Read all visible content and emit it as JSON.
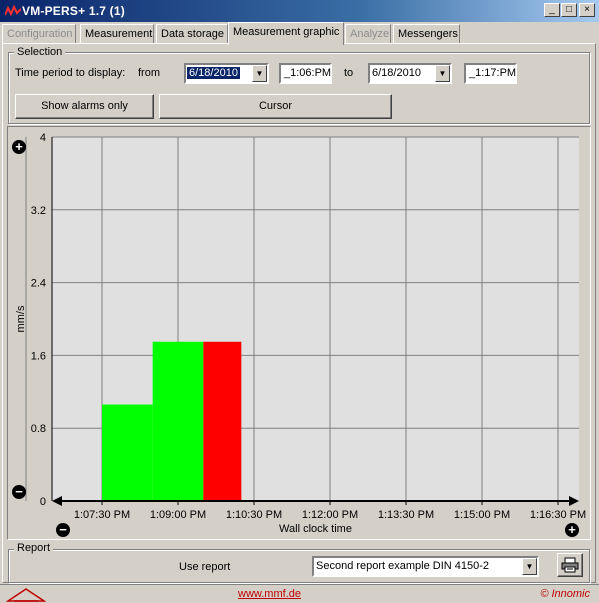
{
  "window": {
    "title": "VM-PERS+ 1.7 (1)",
    "min": "_",
    "max": "□",
    "close": "×"
  },
  "tabs": [
    {
      "label": "Configuration",
      "state": "disabled"
    },
    {
      "label": "Measurement",
      "state": "normal"
    },
    {
      "label": "Data storage",
      "state": "normal"
    },
    {
      "label": "Measurement graphic",
      "state": "active"
    },
    {
      "label": "Analyze",
      "state": "disabled"
    },
    {
      "label": "Messengers",
      "state": "normal"
    }
  ],
  "selection": {
    "group_label": "Selection",
    "time_period_label": "Time period to display:",
    "from_label": "from",
    "from_date": "6/18/2010",
    "from_time": "_1:06:PM",
    "to_label": "to",
    "to_date": "6/18/2010",
    "to_time": "_1:17:PM",
    "show_alarms_button": "Show alarms only",
    "cursor_button": "Cursor"
  },
  "chart_data": {
    "type": "bar",
    "title": "",
    "xlabel": "Wall clock time",
    "ylabel": "mm/s",
    "ylim": [
      0,
      4
    ],
    "yticks": [
      "0",
      "0.8",
      "1.6",
      "2.4",
      "3.2",
      "4"
    ],
    "xtick_labels": [
      "1:07:30 PM",
      "1:09:00 PM",
      "1:10:30 PM",
      "1:12:00 PM",
      "1:13:30 PM",
      "1:15:00 PM",
      "1:16:30 PM"
    ],
    "grid": true,
    "background": "#e0e0e0",
    "bars": [
      {
        "start": "1:07:30 PM",
        "end": "1:08:30 PM",
        "value": 1.06,
        "color": "#00ff00"
      },
      {
        "start": "1:08:30 PM",
        "end": "1:09:30 PM",
        "value": 1.75,
        "color": "#00ff00"
      },
      {
        "start": "1:09:30 PM",
        "end": "1:10:15 PM",
        "value": 1.75,
        "color": "#ff0000"
      }
    ]
  },
  "chart_controls": {
    "zoom_in": "+",
    "zoom_out": "−"
  },
  "report": {
    "group_label": "Report",
    "use_report_label": "Use report",
    "selected_report": "Second report example DIN 4150-2",
    "print_icon": "printer-icon"
  },
  "status": {
    "url": "www.mmf.de",
    "copyright": "© Innomic"
  }
}
